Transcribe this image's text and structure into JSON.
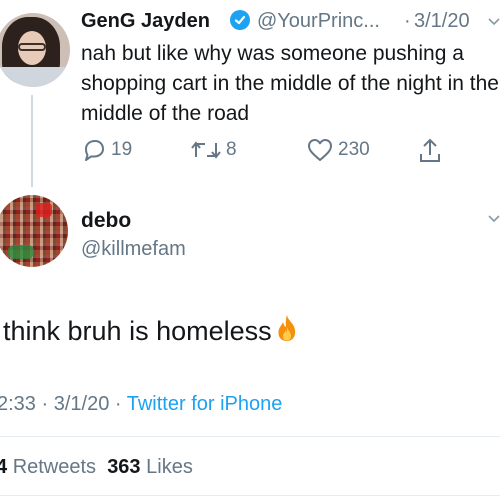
{
  "tweet1": {
    "display_name": "GenG Jayden",
    "handle": "@YourPrinc...",
    "separator": "·",
    "date": "3/1/20",
    "text": "nah but like why was someone pushing a shopping cart in the middle of the night in the middle of the road",
    "replies": "19",
    "retweets": "8",
    "likes": "230"
  },
  "tweet2": {
    "display_name": "debo",
    "handle": "@killmefam",
    "text": "think bruh is homeless",
    "time": "2:33",
    "date": "3/1/20",
    "meta_sep1": " · ",
    "meta_sep2": " · ",
    "source": "Twitter for iPhone",
    "retweets_count": "4",
    "retweets_label": "Retweets",
    "likes_count": "363",
    "likes_label": "Likes"
  },
  "icons": {
    "verified": "verified-badge-icon",
    "reply": "reply-icon",
    "retweet": "retweet-icon",
    "like": "heart-icon",
    "share": "share-icon",
    "emoji": "fire-emoji-icon",
    "more": "chevron-down-icon"
  },
  "colors": {
    "accent": "#1da1f2",
    "secondary_text": "#657786",
    "primary_text": "#14171a"
  }
}
